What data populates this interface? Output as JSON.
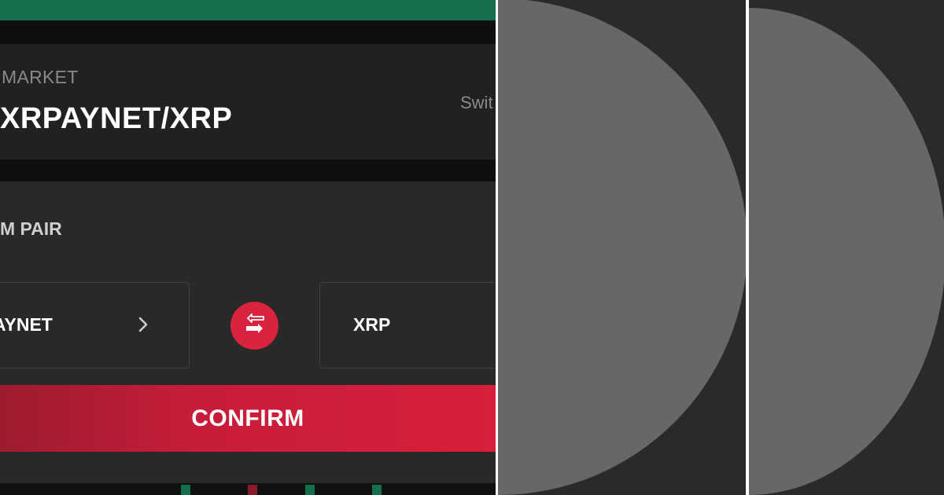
{
  "market": {
    "label": "MARKET",
    "pair": "XRPAYNET/XRP",
    "switch_text": "Swit"
  },
  "pair_selector": {
    "title": "M PAIR",
    "from_token": "AYNET",
    "to_token": "XRP"
  },
  "confirm_label": "CONFIRM",
  "colors": {
    "accent_red": "#d9233f",
    "green": "#146f4b",
    "card_bg": "#292929",
    "placeholder_circle": "#676767"
  },
  "icons": {
    "swap": "swap-arrows-icon",
    "chevron": "chevron-right-icon",
    "placeholder": "placeholder-circle-icon"
  }
}
